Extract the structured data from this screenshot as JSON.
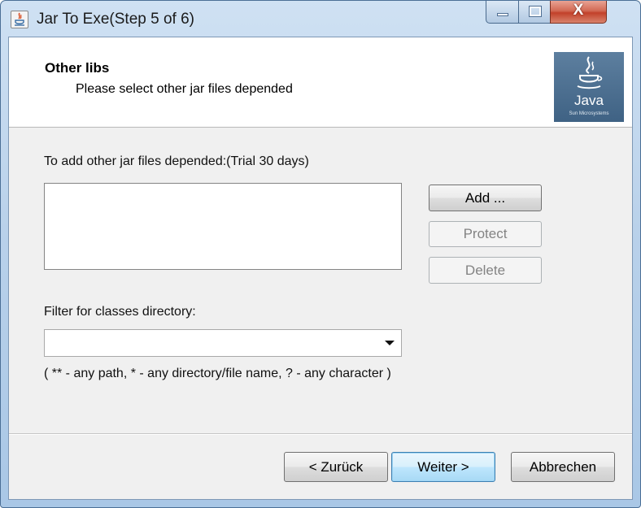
{
  "window": {
    "title": "Jar To Exe(Step 5 of 6)",
    "controls": {
      "minimize": "",
      "maximize": "",
      "close": "X"
    }
  },
  "header": {
    "title": "Other libs",
    "subtitle": "Please select other jar files depended",
    "logo_text": "Java",
    "logo_small_text": "Sun Microsystems"
  },
  "libs": {
    "label": "To add other jar files depended:(Trial 30 days)",
    "items": [],
    "buttons": {
      "add": "Add ...",
      "protect": "Protect",
      "delete": "Delete"
    }
  },
  "filter": {
    "label": "Filter for classes directory:",
    "value": "",
    "hint": "( ** - any path, * - any directory/file name, ? - any character )"
  },
  "footer": {
    "back": "< Zurück",
    "next": "Weiter >",
    "cancel": "Abbrechen"
  },
  "colors": {
    "title_bar": "#b9d1ea",
    "close_button": "#c2412a",
    "dialog_background": "#f0f0f0",
    "default_button": "#bee6fd",
    "java_logo_background": "#3f6284"
  }
}
